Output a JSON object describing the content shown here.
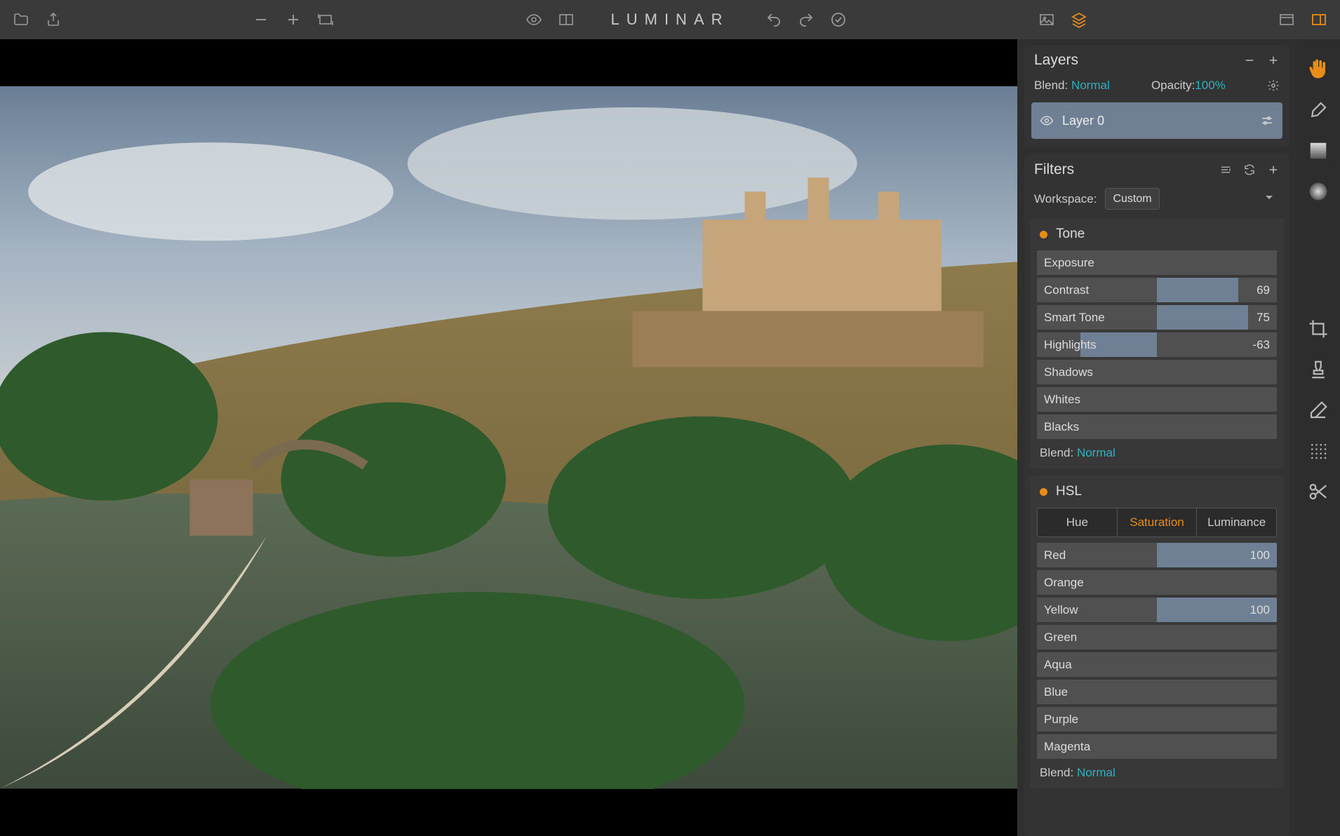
{
  "app_title": "LUMINAR",
  "accent_color": "#e88c1a",
  "link_color": "#2fb0bf",
  "layers_panel": {
    "title": "Layers",
    "blend_label": "Blend:",
    "blend_value": "Normal",
    "opacity_label": "Opacity:",
    "opacity_value": "100%",
    "items": [
      {
        "name": "Layer 0",
        "visible": true
      }
    ]
  },
  "filters_panel": {
    "title": "Filters",
    "workspace_label": "Workspace:",
    "workspace_value": "Custom",
    "filters": [
      {
        "name": "Tone",
        "sliders": [
          {
            "label": "Exposure",
            "value": null,
            "fill_start": 50,
            "fill_end": 50
          },
          {
            "label": "Contrast",
            "value": "69",
            "fill_start": 50,
            "fill_end": 84
          },
          {
            "label": "Smart Tone",
            "value": "75",
            "fill_start": 50,
            "fill_end": 88
          },
          {
            "label": "Highlights",
            "value": "-63",
            "fill_start": 18,
            "fill_end": 50
          },
          {
            "label": "Shadows",
            "value": null,
            "fill_start": 50,
            "fill_end": 50
          },
          {
            "label": "Whites",
            "value": null,
            "fill_start": 50,
            "fill_end": 50
          },
          {
            "label": "Blacks",
            "value": null,
            "fill_start": 50,
            "fill_end": 50
          }
        ],
        "blend_label": "Blend:",
        "blend_value": "Normal"
      },
      {
        "name": "HSL",
        "tabs": [
          "Hue",
          "Saturation",
          "Luminance"
        ],
        "active_tab": 1,
        "sliders": [
          {
            "label": "Red",
            "value": "100",
            "fill_start": 50,
            "fill_end": 100
          },
          {
            "label": "Orange",
            "value": null,
            "fill_start": 50,
            "fill_end": 50
          },
          {
            "label": "Yellow",
            "value": "100",
            "fill_start": 50,
            "fill_end": 100
          },
          {
            "label": "Green",
            "value": null,
            "fill_start": 50,
            "fill_end": 50
          },
          {
            "label": "Aqua",
            "value": null,
            "fill_start": 50,
            "fill_end": 50
          },
          {
            "label": "Blue",
            "value": null,
            "fill_start": 50,
            "fill_end": 50
          },
          {
            "label": "Purple",
            "value": null,
            "fill_start": 50,
            "fill_end": 50
          },
          {
            "label": "Magenta",
            "value": null,
            "fill_start": 50,
            "fill_end": 50
          }
        ],
        "blend_label": "Blend:",
        "blend_value": "Normal"
      }
    ]
  }
}
